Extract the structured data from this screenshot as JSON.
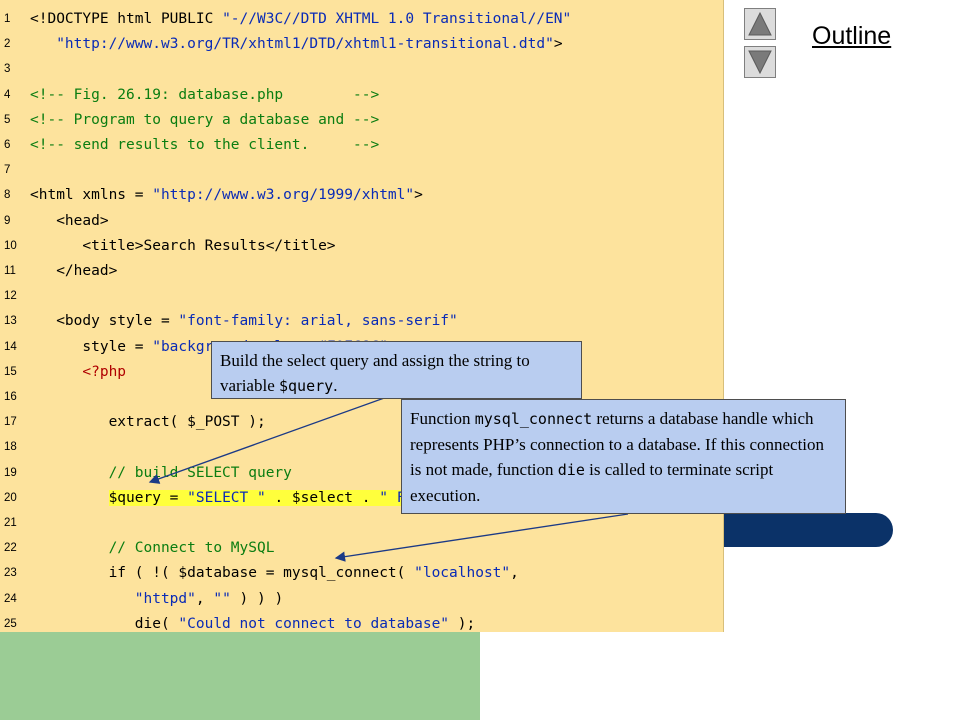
{
  "outline": {
    "label": "Outline"
  },
  "nav": {
    "up_icon": "triangle-up-icon",
    "down_icon": "triangle-down-icon"
  },
  "code_lines": [
    {
      "num": "1",
      "tokens": [
        {
          "t": "<!DOCTYPE html PUBLIC "
        },
        {
          "t": "\"-//W3C//DTD XHTML 1.0 Transitional//EN\"",
          "c": "string"
        }
      ]
    },
    {
      "num": "2",
      "tokens": [
        {
          "t": "   "
        },
        {
          "t": "\"http://www.w3.org/TR/xhtml1/DTD/xhtml1-transitional.dtd\"",
          "c": "string"
        },
        {
          "t": ">"
        }
      ]
    },
    {
      "num": "3",
      "tokens": []
    },
    {
      "num": "4",
      "tokens": [
        {
          "t": "<!-- Fig. 26.19: database.php        -->",
          "c": "comment"
        }
      ]
    },
    {
      "num": "5",
      "tokens": [
        {
          "t": "<!-- Program to query a database and -->",
          "c": "comment"
        }
      ]
    },
    {
      "num": "6",
      "tokens": [
        {
          "t": "<!-- send results to the client.     -->",
          "c": "comment"
        }
      ]
    },
    {
      "num": "7",
      "tokens": []
    },
    {
      "num": "8",
      "tokens": [
        {
          "t": "<html xmlns = "
        },
        {
          "t": "\"http://www.w3.org/1999/xhtml\"",
          "c": "string"
        },
        {
          "t": ">"
        }
      ]
    },
    {
      "num": "9",
      "tokens": [
        {
          "t": "   <head>"
        }
      ]
    },
    {
      "num": "10",
      "tokens": [
        {
          "t": "      <title>Search Results</title>"
        }
      ]
    },
    {
      "num": "11",
      "tokens": [
        {
          "t": "   </head>"
        }
      ]
    },
    {
      "num": "12",
      "tokens": []
    },
    {
      "num": "13",
      "tokens": [
        {
          "t": "   <body style = "
        },
        {
          "t": "\"font-family: arial, sans-serif\"",
          "c": "string"
        }
      ]
    },
    {
      "num": "14",
      "tokens": [
        {
          "t": "      style = "
        },
        {
          "t": "\"background-color: #F0E68C\"",
          "c": "string"
        },
        {
          "t": ">"
        }
      ]
    },
    {
      "num": "15",
      "tokens": [
        {
          "t": "      <?php",
          "c": "php"
        }
      ]
    },
    {
      "num": "16",
      "tokens": []
    },
    {
      "num": "17",
      "tokens": [
        {
          "t": "         extract( $_POST );"
        }
      ]
    },
    {
      "num": "18",
      "tokens": []
    },
    {
      "num": "19",
      "tokens": [
        {
          "t": "         // build SELECT query",
          "c": "comment"
        }
      ]
    },
    {
      "num": "20",
      "highlight": true,
      "tokens": [
        {
          "t": "         "
        },
        {
          "t": "$query = ",
          "c": "hl"
        },
        {
          "t": "\"SELECT \"",
          "c": "hl-string"
        },
        {
          "t": " . $select . ",
          "c": "hl"
        },
        {
          "t": "\" FROM Books\"",
          "c": "hl-string"
        },
        {
          "t": ";",
          "c": "hl"
        }
      ]
    },
    {
      "num": "21",
      "tokens": []
    },
    {
      "num": "22",
      "tokens": [
        {
          "t": "         // Connect to MySQL",
          "c": "comment"
        }
      ]
    },
    {
      "num": "23",
      "tokens": [
        {
          "t": "         if ( !( $database = mysql_connect( "
        },
        {
          "t": "\"localhost\"",
          "c": "string"
        },
        {
          "t": ","
        }
      ]
    },
    {
      "num": "24",
      "tokens": [
        {
          "t": "            "
        },
        {
          "t": "\"httpd\"",
          "c": "string"
        },
        {
          "t": ", "
        },
        {
          "t": "\"\"",
          "c": "string"
        },
        {
          "t": " ) ) )"
        }
      ]
    },
    {
      "num": "25",
      "tokens": [
        {
          "t": "            die( "
        },
        {
          "t": "\"Could not connect to database\"",
          "c": "string"
        },
        {
          "t": " );"
        }
      ]
    }
  ],
  "callout1": {
    "before": "Build the select query and assign the string to variable ",
    "code": "$query",
    "after": "."
  },
  "callout2": {
    "p1": "Function ",
    "c1": "mysql_connect",
    "p2": " returns a database handle which represents PHP’s connection to a database. If this connection is not made, function ",
    "c2": "die",
    "p3": " is called to terminate script execution."
  }
}
